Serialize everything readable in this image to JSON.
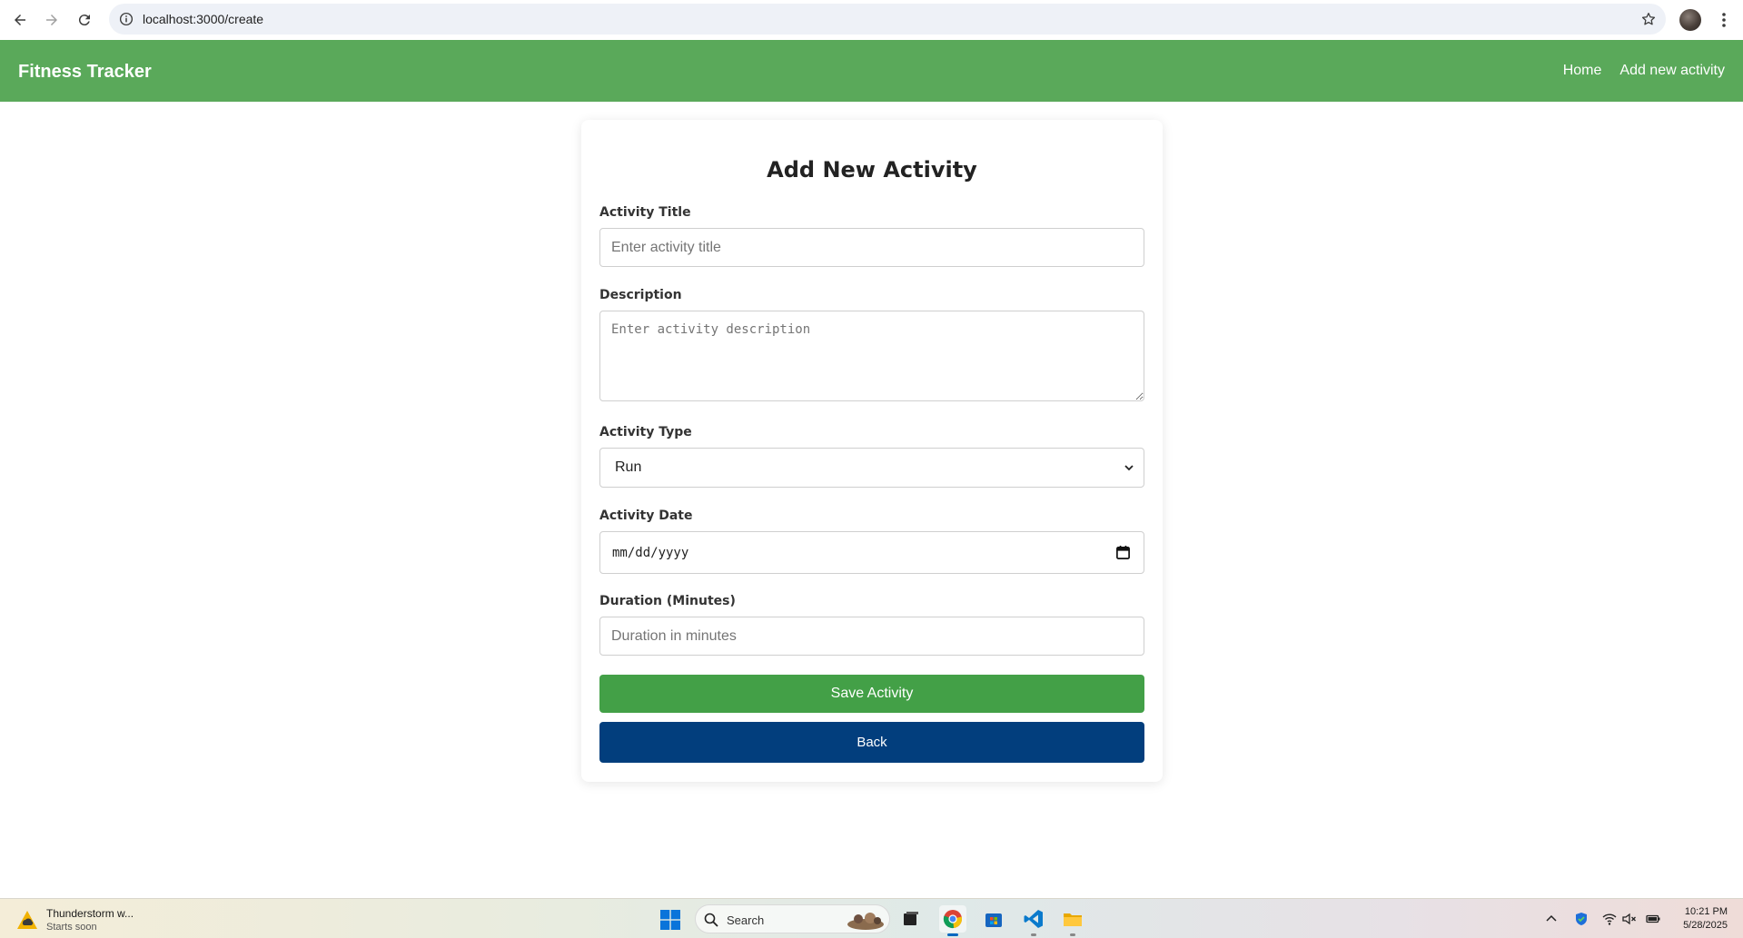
{
  "browser": {
    "url": "localhost:3000/create"
  },
  "navbar": {
    "brand": "Fitness Tracker",
    "links": [
      "Home",
      "Add new activity"
    ],
    "color": "#5aa95a"
  },
  "form": {
    "title": "Add New Activity",
    "title_field": {
      "label": "Activity Title",
      "placeholder": "Enter activity title",
      "value": ""
    },
    "description_field": {
      "label": "Description",
      "placeholder": "Enter activity description",
      "value": ""
    },
    "type_field": {
      "label": "Activity Type",
      "selected": "Run"
    },
    "date_field": {
      "label": "Activity Date",
      "value": "mm/dd/yyyy"
    },
    "duration_field": {
      "label": "Duration (Minutes)",
      "placeholder": "Duration in minutes",
      "value": ""
    },
    "save_label": "Save Activity",
    "back_label": "Back",
    "save_color": "#43a047",
    "back_color": "#023e7d"
  },
  "taskbar": {
    "weather_title": "Thunderstorm w...",
    "weather_sub": "Starts soon",
    "search_label": "Search",
    "time": "10:21 PM",
    "date": "5/28/2025"
  }
}
